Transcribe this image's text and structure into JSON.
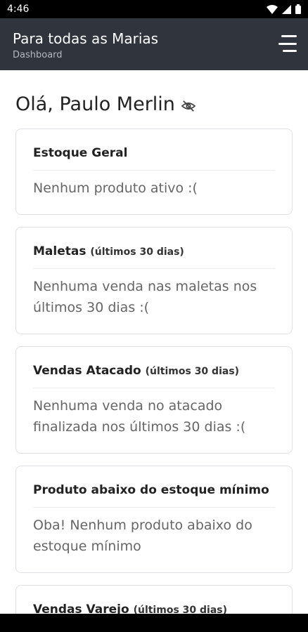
{
  "status_bar": {
    "time": "4:46"
  },
  "app_bar": {
    "title": "Para todas as Marias",
    "subtitle": "Dashboard"
  },
  "greeting": {
    "text": "Olá, Paulo Merlin"
  },
  "cards": [
    {
      "title": "Estoque Geral",
      "subtitle": "",
      "body": "Nenhum produto ativo :("
    },
    {
      "title": "Maletas",
      "subtitle": "(últimos 30 dias)",
      "body": "Nenhuma venda nas maletas nos últimos 30 dias :("
    },
    {
      "title": "Vendas Atacado",
      "subtitle": "(últimos 30 dias)",
      "body": "Nenhuma venda no atacado finalizada nos últimos 30 dias :("
    },
    {
      "title": "Produto abaixo do estoque mínimo",
      "subtitle": "",
      "body": "Oba! Nenhum produto abaixo do estoque mínimo"
    },
    {
      "title": "Vendas Varejo",
      "subtitle": "(últimos 30 dias)",
      "body": ""
    }
  ],
  "icons": {
    "menu": "menu-icon",
    "visibility": "eye-off-icon",
    "wifi": "wifi-icon",
    "signal": "signal-icon",
    "battery": "battery-icon"
  },
  "colors": {
    "app_bar": "#2f343d",
    "text_muted": "#666666"
  }
}
